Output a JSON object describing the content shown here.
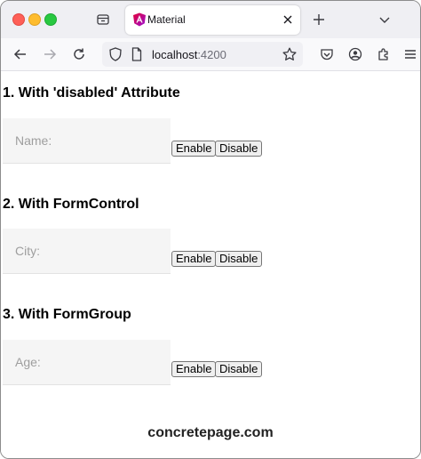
{
  "browser": {
    "tab_title": "Material",
    "url_host": "localhost",
    "url_port": ":4200"
  },
  "sections": [
    {
      "heading": "1. With 'disabled' Attribute",
      "field_label": "Name:",
      "enable_label": "Enable",
      "disable_label": "Disable"
    },
    {
      "heading": "2. With FormControl",
      "field_label": "City:",
      "enable_label": "Enable",
      "disable_label": "Disable"
    },
    {
      "heading": "3. With FormGroup",
      "field_label": "Age:",
      "enable_label": "Enable",
      "disable_label": "Disable"
    }
  ],
  "footer": {
    "text": "concretepage.com"
  },
  "icons": {
    "favicon": "angular-logo-icon",
    "accent": "#c3002f"
  }
}
